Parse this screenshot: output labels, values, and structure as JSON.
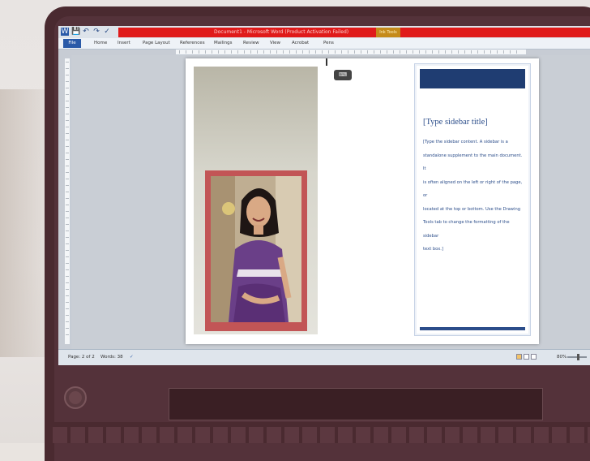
{
  "title": "Document1 - Microsoft Word (Product Activation Failed)",
  "ink_tools_label": "Ink Tools",
  "quick_access": [
    "W",
    "💾",
    "↶",
    "↷",
    "✓"
  ],
  "tabs": [
    {
      "label": "File"
    },
    {
      "label": "Home"
    },
    {
      "label": "Insert"
    },
    {
      "label": "Page Layout"
    },
    {
      "label": "References"
    },
    {
      "label": "Mailings"
    },
    {
      "label": "Review"
    },
    {
      "label": "View"
    },
    {
      "label": "Acrobat"
    },
    {
      "label": "Pens"
    }
  ],
  "document": {
    "sidebar_title": "[Type sidebar title]",
    "sidebar_lines": [
      "[Type the sidebar content. A sidebar is a",
      "standalone supplement to the main document. It",
      "is often aligned on the left or right of the page, or",
      "located at the top or bottom. Use the Drawing",
      "Tools tab to change the formatting of the sidebar",
      "text box.]"
    ],
    "keyboard_icon": "keyboard-icon"
  },
  "status": {
    "page": "Page: 2 of 2",
    "words": "Words: 38",
    "zoom": "80%"
  },
  "colors": {
    "title_strip": "#e01a1a",
    "ink_tools": "#c58a1a",
    "sidebar_band": "#1f3d72",
    "sidebar_text": "#2b4d8a",
    "photo_frame": "#c25556",
    "laptop_body": "#4a2a30"
  }
}
